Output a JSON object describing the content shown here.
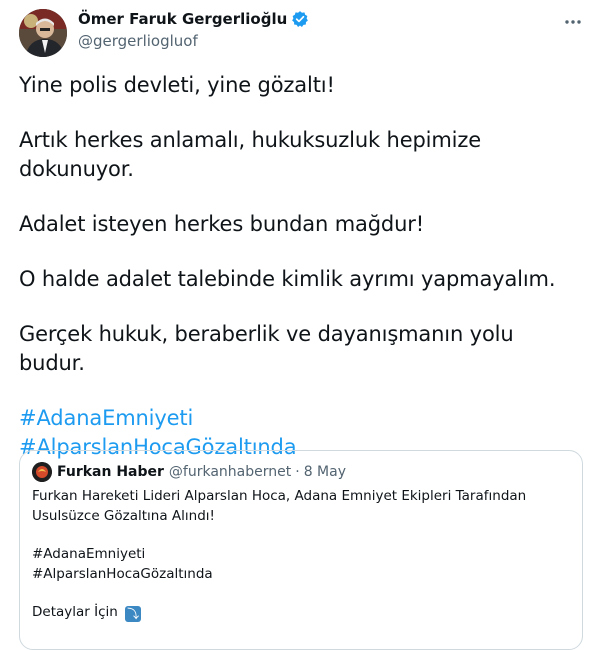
{
  "author": {
    "name": "Ömer Faruk Gergerlioğlu",
    "handle": "@gergerliogluof",
    "verified": true
  },
  "tweet": {
    "lines": [
      "Yine polis devleti, yine gözaltı!",
      "Artık herkes anlamalı, hukuksuzluk hepimize dokunuyor.",
      "Adalet isteyen herkes bundan mağdur!",
      "O halde adalet talebinde kimlik ayrımı yapmayalım.",
      "Gerçek hukuk, beraberlik ve dayanışmanın yolu budur."
    ],
    "hashtags": [
      "#AdanaEmniyeti",
      "#AlparslanHocaGözaltında"
    ]
  },
  "quote": {
    "name": "Furkan Haber",
    "handle": "@furkanhabernet",
    "separator": "·",
    "date": "8 May",
    "text": "Furkan Hareketi Lideri Alparslan Hoca, Adana Emniyet Ekipleri Tarafından Usulsüzce Gözaltına Alındı!",
    "hashtags": [
      "#AdanaEmniyeti",
      "#AlparslanHocaGözaltında"
    ],
    "details": "Detaylar İçin",
    "details_emoji": "⤵"
  },
  "colors": {
    "link": "#1d9bf0",
    "secondary_text": "#536471",
    "verified_badge": "#1d9bf0",
    "card_border": "#cfd9de"
  },
  "icons": {
    "verified": "verified-badge-icon",
    "more": "more-options-icon",
    "details_arrow": "arrow-down-right-emoji-icon"
  }
}
